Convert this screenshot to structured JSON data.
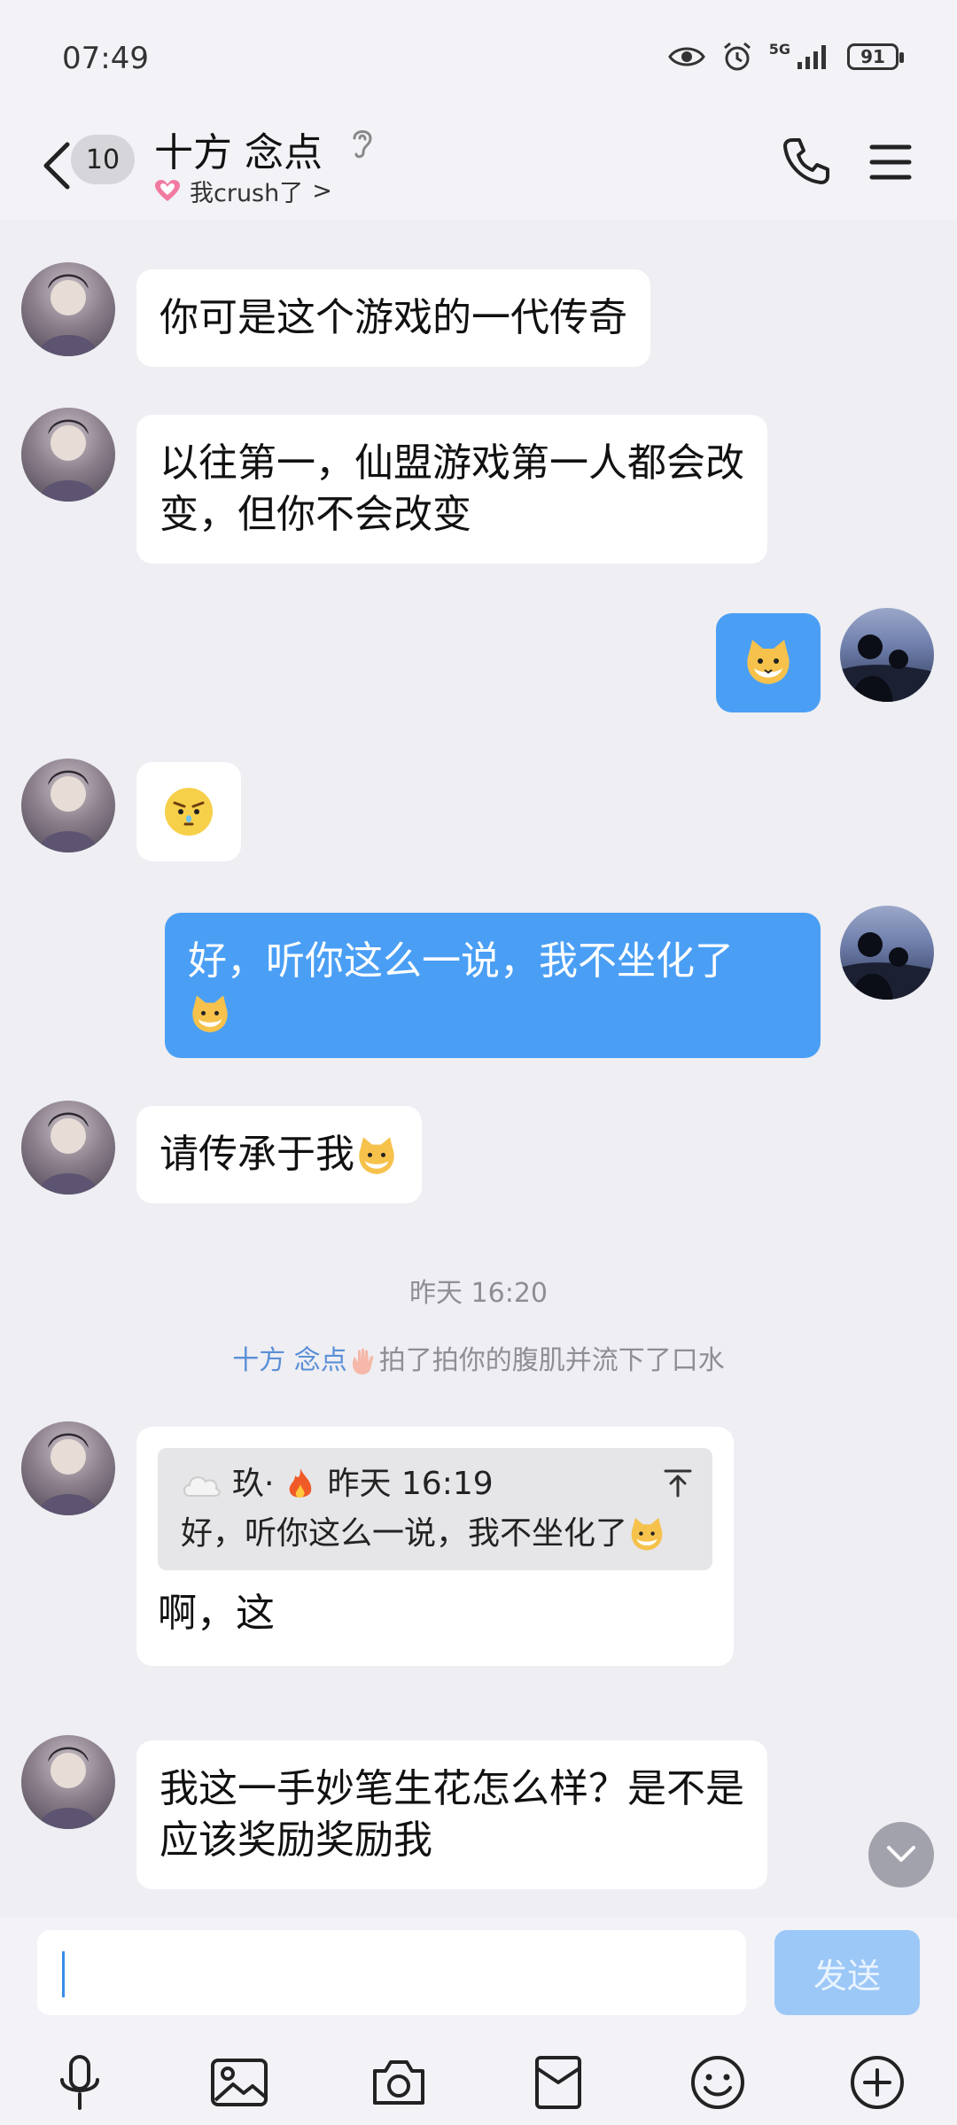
{
  "status": {
    "time": "07:49",
    "battery": "91",
    "network": "5G"
  },
  "header": {
    "unread_count": "10",
    "title": "十方  念点",
    "subtitle": "我crush了",
    "subtitle_chevron": ">"
  },
  "messages": [
    {
      "side": "peer",
      "text": "你可是这个游戏的一代传奇"
    },
    {
      "side": "peer",
      "line1": "以往第一，仙盟游戏第一人都会改",
      "line2": "变，但你不会改变"
    },
    {
      "side": "self",
      "sticker": "cat-sticker-icon"
    },
    {
      "side": "peer",
      "sticker": "annoyed-face-icon"
    },
    {
      "side": "self",
      "text": "好，听你这么一说，我不坐化了"
    },
    {
      "side": "peer",
      "text": "请传承于我"
    }
  ],
  "timestamp": "昨天 16:20",
  "system_message": {
    "actor": "十方  念点",
    "action": "拍了拍你的腹肌并流下了口水"
  },
  "reply_message": {
    "quote_author": "玖·",
    "quote_time": "昨天 16:19",
    "quote_text": "好，听你这么一说，我不坐化了",
    "text": "啊，这"
  },
  "last_message": {
    "line1": "我这一手妙笔生花怎么样？是不是",
    "line2": "应该奖励奖励我"
  },
  "input": {
    "value": "",
    "send_label": "发送"
  },
  "colors": {
    "self_bubble": "#4a9ff5",
    "peer_bubble": "#ffffff",
    "background": "#eeeef3",
    "send_button": "#9cc8f7"
  }
}
